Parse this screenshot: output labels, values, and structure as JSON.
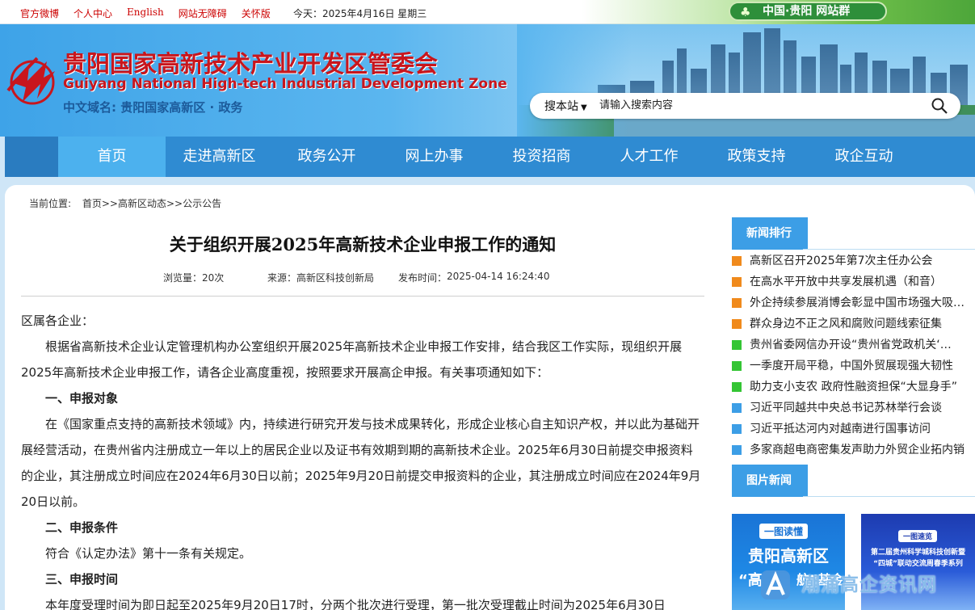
{
  "topbar": {
    "links": [
      "官方微博",
      "个人中心",
      "English",
      "网站无障碍",
      "关怀版"
    ],
    "today_label": "今天：2025年4月16日  星期三",
    "site_group_label": "中国·贵阳  网站群"
  },
  "header": {
    "title_cn": "贵阳国家高新技术产业开发区管委会",
    "title_en": "Guiyang National High-tech Industrial Development Zone",
    "domain": "中文域名: 贵阳国家高新区 · 政务",
    "search": {
      "scope": "搜本站",
      "placeholder": "请输入搜索内容"
    }
  },
  "nav": {
    "items": [
      "首页",
      "走进高新区",
      "政务公开",
      "网上办事",
      "投资招商",
      "人才工作",
      "政策支持",
      "政企互动"
    ],
    "active_index": 0
  },
  "breadcrumb": {
    "label": "当前位置:",
    "path": "首页>>高新区动态>>公示公告"
  },
  "article": {
    "title": "关于组织开展2025年高新技术企业申报工作的通知",
    "views": "浏览量：20次",
    "source_label": "来源：",
    "source": "高新区科技创新局",
    "publish_label": "发布时间：",
    "publish_time": "2025-04-14 16:24:40",
    "salutation": "区属各企业：",
    "p1": "根据省高新技术企业认定管理机构办公室组织开展2025年高新技术企业申报工作安排，结合我区工作实际，现组织开展2025年高新技术企业申报工作，请各企业高度重视，按照要求开展高企申报。有关事项通知如下：",
    "h1": "一、申报对象",
    "p2": "在《国家重点支持的高新技术领域》内，持续进行研究开发与技术成果转化，形成企业核心自主知识产权，并以此为基础开展经营活动，在贵州省内注册成立一年以上的居民企业以及证书有效期到期的高新技术企业。2025年6月30日前提交申报资料的企业，其注册成立时间应在2024年6月30日以前；2025年9月20日前提交申报资料的企业，其注册成立时间应在2024年9月20日以前。",
    "h2": "二、申报条件",
    "p3": "符合《认定办法》第十一条有关规定。",
    "h3": "三、申报时间",
    "p4": "本年度受理时间为即日起至2025年9月20日17时，分两个批次进行受理，第一批次受理截止时间为2025年6月30日"
  },
  "sidebar": {
    "news_rank_title": "新闻排行",
    "news": [
      {
        "text": "高新区召开2025年第7次主任办公会",
        "color": "#f08a1c"
      },
      {
        "text": "在高水平开放中共享发展机遇（和音）",
        "color": "#f08a1c"
      },
      {
        "text": "外企持续参展消博会彰显中国市场强大吸引力",
        "color": "#f08a1c"
      },
      {
        "text": "群众身边不正之风和腐败问题线索征集",
        "color": "#f08a1c"
      },
      {
        "text": "贵州省委网信办开设“贵州省党政机关‘…",
        "color": "#34c534"
      },
      {
        "text": "一季度开局平稳，中国外贸展现强大韧性",
        "color": "#34c534"
      },
      {
        "text": "助力支小支农  政府性融资担保“大显身手”",
        "color": "#34c534"
      },
      {
        "text": "习近平同越共中央总书记苏林举行会谈",
        "color": "#3c9ee6"
      },
      {
        "text": "习近平抵达河内对越南进行国事访问",
        "color": "#3c9ee6"
      },
      {
        "text": "多家商超电商密集发声助力外贸企业拓内销",
        "color": "#3c9ee6"
      }
    ],
    "pic_news_title": "图片新闻",
    "pic1": {
      "tag": "一图读懂",
      "line1": "贵阳高新区",
      "line2": "“高",
      "line3": "航”基金"
    },
    "pic2": {
      "tag": "一图速览",
      "line1": "第二届贵州科学城科技创新暨",
      "line2": "“四城”联动交流周春季系列"
    }
  },
  "watermark": {
    "text": "潮涌高企资讯网"
  },
  "colors": {
    "nav": "#2f8bd2",
    "nav_active": "#4cb1ee",
    "brand_red": "#c8161d",
    "tab_blue": "#3c9ee6"
  }
}
